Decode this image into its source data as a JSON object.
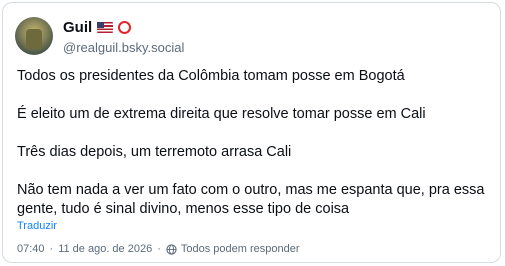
{
  "post": {
    "author": {
      "display_name": "Guil",
      "handle": "@realguil.bsky.social",
      "badges": [
        "us-flag-icon",
        "red-circle-icon"
      ]
    },
    "paragraphs": [
      "Todos os presidentes da Colômbia tomam posse em Bogotá",
      "É eleito um de extrema direita que resolve tomar posse em Cali",
      "Três dias depois, um terremoto arrasa Cali",
      "Não tem nada a ver um fato com o outro, mas me espanta que, pra essa gente, tudo é sinal divino, menos esse tipo de coisa"
    ],
    "translate_label": "Traduzir",
    "time": "07:40",
    "date": "11 de ago. de 2026",
    "reply_setting": "Todos podem responder"
  },
  "colors": {
    "link": "#1083fe",
    "muted": "#5b6b7c",
    "text": "#0b0f14",
    "border": "#d4dbe2"
  }
}
